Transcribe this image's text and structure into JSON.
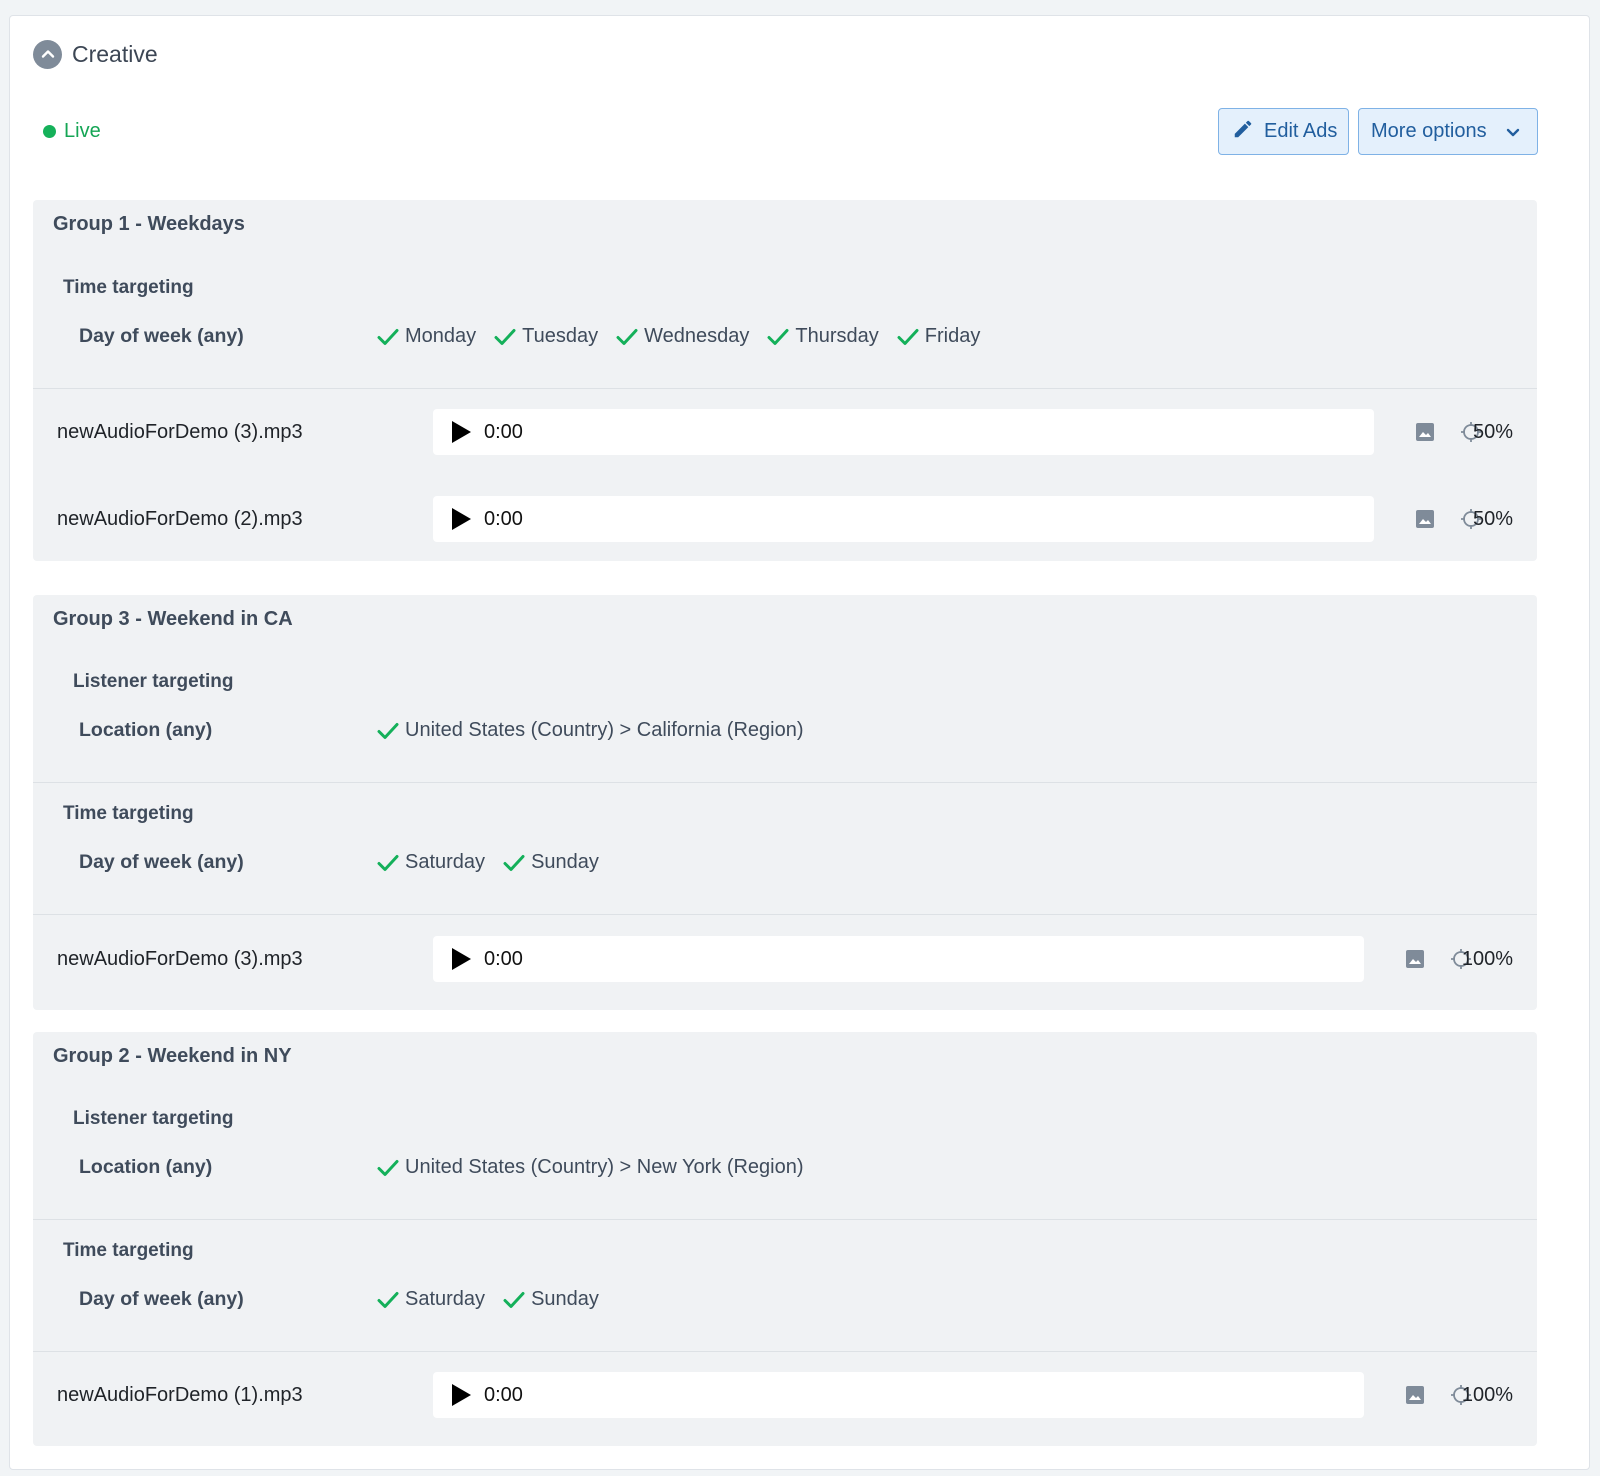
{
  "section": {
    "title": "Creative",
    "collapse_icon": "chevron-up-icon"
  },
  "status": {
    "label": "Live",
    "color": "#15b15a"
  },
  "actions": {
    "edit_ads": {
      "label": "Edit Ads",
      "icon": "pencil-icon"
    },
    "more_options": {
      "label": "More options",
      "icon": "chevron-down-icon"
    }
  },
  "groups": [
    {
      "title": "Group 1 - Weekdays",
      "time_targeting": {
        "title": "Time targeting",
        "label": "Day of week (any)",
        "values": [
          "Monday",
          "Tuesday",
          "Wednesday",
          "Thursday",
          "Friday"
        ]
      },
      "ads": [
        {
          "file": "newAudioForDemo (3).mp3",
          "time": "0:00",
          "percent": "50%"
        },
        {
          "file": "newAudioForDemo (2).mp3",
          "time": "0:00",
          "percent": "50%"
        }
      ]
    },
    {
      "title": "Group 3 - Weekend in CA",
      "listener_targeting": {
        "title": "Listener targeting",
        "label": "Location (any)",
        "values": [
          "United States (Country) > California (Region)"
        ]
      },
      "time_targeting": {
        "title": "Time targeting",
        "label": "Day of week (any)",
        "values": [
          "Saturday",
          "Sunday"
        ]
      },
      "ads": [
        {
          "file": "newAudioForDemo (3).mp3",
          "time": "0:00",
          "percent": "100%"
        }
      ]
    },
    {
      "title": "Group 2 - Weekend in NY",
      "listener_targeting": {
        "title": "Listener targeting",
        "label": "Location (any)",
        "values": [
          "United States (Country) > New York (Region)"
        ]
      },
      "time_targeting": {
        "title": "Time targeting",
        "label": "Day of week (any)",
        "values": [
          "Saturday",
          "Sunday"
        ]
      },
      "ads": [
        {
          "file": "newAudioForDemo (1).mp3",
          "time": "0:00",
          "percent": "100%"
        }
      ]
    }
  ]
}
